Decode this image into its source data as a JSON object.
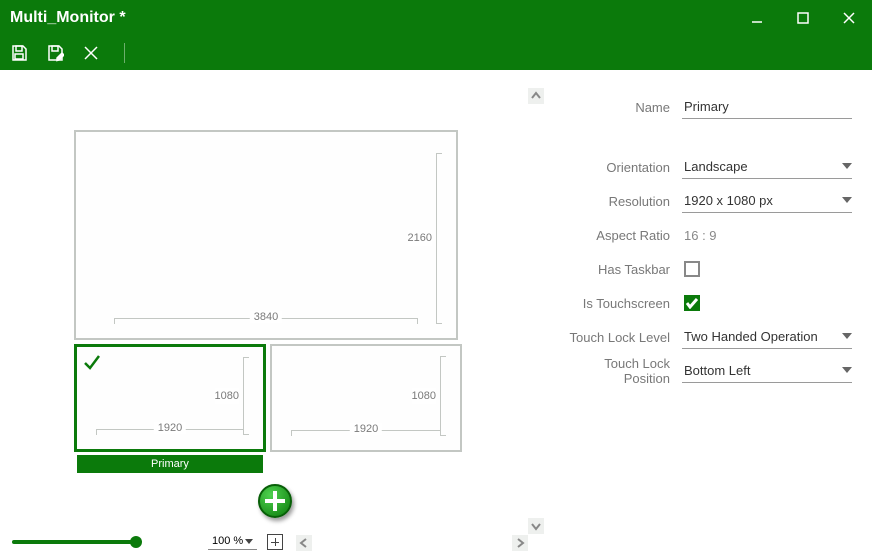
{
  "window": {
    "title": "Multi_Monitor *"
  },
  "monitors": {
    "big": {
      "w": "3840",
      "h": "2160"
    },
    "small1": {
      "w": "1920",
      "h": "1080"
    },
    "small2": {
      "w": "1920",
      "h": "1080"
    },
    "primary_label": "Primary"
  },
  "zoom": {
    "value": "100 %"
  },
  "props": {
    "name": {
      "label": "Name",
      "value": "Primary"
    },
    "orientation": {
      "label": "Orientation",
      "value": "Landscape"
    },
    "resolution": {
      "label": "Resolution",
      "value": "1920 x 1080 px"
    },
    "aspect": {
      "label": "Aspect Ratio",
      "value": "16 : 9"
    },
    "taskbar": {
      "label": "Has Taskbar"
    },
    "touch": {
      "label": "Is Touchscreen"
    },
    "locklevel": {
      "label": "Touch Lock Level",
      "value": "Two Handed Operation"
    },
    "lockpos": {
      "label": "Touch Lock Position",
      "value": "Bottom Left"
    }
  }
}
